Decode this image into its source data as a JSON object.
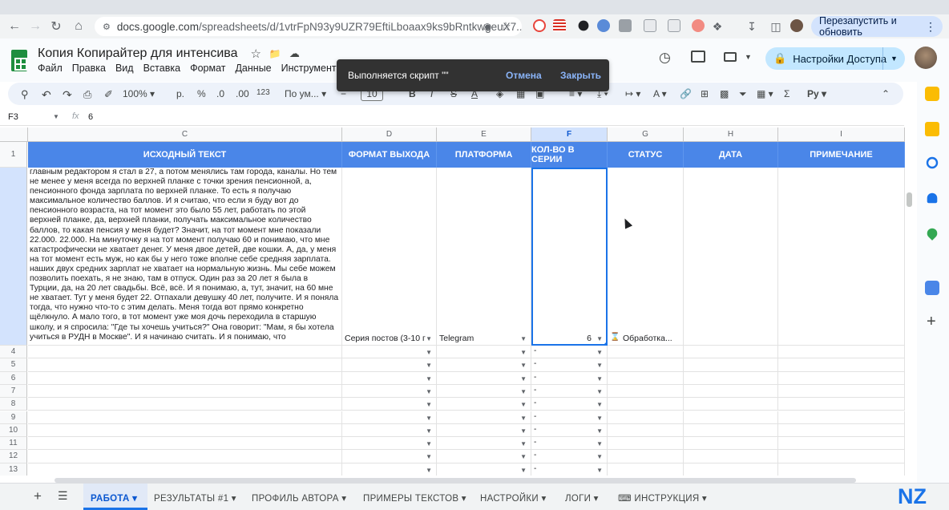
{
  "browser": {
    "url_host": "docs.google.com",
    "url_path": "/spreadsheets/d/1vtrFpN93y9UZR79EftiLboaax9ks9bRntkwgeuX7...",
    "relaunch_label": "Перезапустить и обновить"
  },
  "doc": {
    "title": "Копия Копирайтер для интенсива",
    "menu": [
      "Файл",
      "Правка",
      "Вид",
      "Вставка",
      "Формат",
      "Данные",
      "Инструменты"
    ],
    "share_label": "Настройки Доступа"
  },
  "toast": {
    "message": "Выполняется скрипт \"\"",
    "cancel": "Отмена",
    "close": "Закрыть"
  },
  "toolbar": {
    "zoom": "100%",
    "currency": "р.",
    "percent": "%",
    "dec_minus": ".0",
    "dec_plus": ".00",
    "number_format": "123",
    "font": "По ум...",
    "font_size": "10"
  },
  "formula_bar": {
    "cell_ref": "F3",
    "fx": "fx",
    "value": "6"
  },
  "columns": [
    "C",
    "D",
    "E",
    "F",
    "G",
    "H",
    "I"
  ],
  "header_row": {
    "row_num": "1",
    "c": "ИСХОДНЫЙ ТЕКСТ",
    "d": "ФОРМАТ ВЫХОДА",
    "e": "ПЛАТФОРМА",
    "f": "КОЛ-ВО В СЕРИИ",
    "g": "СТАТУС",
    "h": "ДАТА",
    "i": "ПРИМЕЧАНИЕ"
  },
  "row3": {
    "text": "главным редактором я стал в 27, а потом менялись там города, каналы. Но тем не менее у меня всегда по верхней планке с точки зрения пенсионной, а, пенсионного фонда зарплата по верхней планке. То есть я получаю максимальное количество баллов. И я считаю, что если я буду вот до пенсионного возраста, на тот момент это было 55 лет, работать по этой верхней планке, да, верхней планки, получать максимальное количество баллов, то какая пенсия у меня будет? Значит, на тот момент мне показали 22.000. 22.000. На минуточку я на тот момент получаю 60 и понимаю, что мне катастрофически не хватает денег. У меня двое детей, две кошки. А, да, у меня на тот момент есть муж, но как бы у него тоже вполне себе средняя зарплата. наших двух средних зарплат не хватает на нормальную жизнь. Мы себе можем позволить поехать, я не знаю, там в отпуск. Один раз за 20 лет я была в Турции, да, на 20 лет свадьбы. Всё, всё. И я понимаю, а, тут, значит, на 60 мне не хватает. Тут у меня будет 22. Отпахали девушку 40 лет, получите. И я поняла тогда, что нужно что-то с этим делать. Меня тогда вот прямо конкретно щёлкнуло. А мало того, в тот момент уже моя дочь переходила в старшую школу, и я спросила: \"Где ты хочешь учиться?\" Она говорит: \"Мам, я бы хотела учиться в РУДН в Москве\". И я начинаю считать. И я понимаю, что",
    "format": "Серия постов (3-10 г",
    "platform": "Telegram",
    "count": "6",
    "status": "Обработка..."
  },
  "empty_rows": [
    "4",
    "5",
    "6",
    "7",
    "8",
    "9",
    "10",
    "11",
    "12",
    "13"
  ],
  "empty_dash": "-",
  "sheet_tabs": [
    "РАБОТА",
    "РЕЗУЛЬТАТЫ #1",
    "ПРОФИЛЬ АВТОРА",
    "ПРИМЕРЫ ТЕКСТОВ",
    "НАСТРОЙКИ",
    "ЛОГИ",
    "ИНСТРУКЦИЯ"
  ],
  "watermark": "NZ",
  "colors": {
    "header_blue": "#4a86e8",
    "active_tab": "#1a73e8",
    "toast_bg": "#323232"
  }
}
